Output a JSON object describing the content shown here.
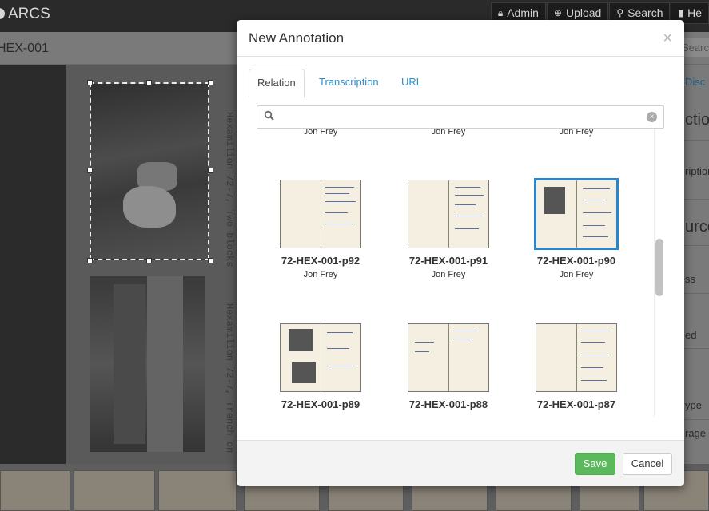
{
  "app": {
    "brand": "ARCS",
    "page_title": "HEX-001"
  },
  "topnav": [
    {
      "label": "Admin",
      "icon": "lock-icon"
    },
    {
      "label": "Upload",
      "icon": "upload-icon"
    },
    {
      "label": "Search",
      "icon": "search-icon"
    },
    {
      "label": "He",
      "icon": "book-icon"
    }
  ],
  "subbar": {
    "search_placeholder": "Searc"
  },
  "viewer": {
    "caption_top": "Hexamilion 72-7, Two blocks",
    "caption_bottom": "Hexamilion 72-7, Trench on"
  },
  "rightpanel": {
    "link": "Disc",
    "section1": "ction",
    "field1": "ription",
    "section2": "urce",
    "field2": "ss",
    "field3": "ed",
    "field4": "ype",
    "field5": "rage"
  },
  "modal": {
    "title": "New Annotation",
    "close": "×",
    "tabs": [
      "Relation",
      "Transcription",
      "URL"
    ],
    "active_tab": "Relation",
    "search": {
      "value": "",
      "placeholder": ""
    },
    "top_row_authors": [
      "Jon Frey",
      "Jon Frey",
      "Jon Frey"
    ],
    "items": [
      {
        "name": "72-HEX-001-p92",
        "author": "Jon Frey",
        "selected": false
      },
      {
        "name": "72-HEX-001-p91",
        "author": "Jon Frey",
        "selected": false
      },
      {
        "name": "72-HEX-001-p90",
        "author": "Jon Frey",
        "selected": true
      },
      {
        "name": "72-HEX-001-p89",
        "author": "",
        "selected": false
      },
      {
        "name": "72-HEX-001-p88",
        "author": "",
        "selected": false
      },
      {
        "name": "72-HEX-001-p87",
        "author": "",
        "selected": false
      }
    ],
    "buttons": {
      "save": "Save",
      "cancel": "Cancel"
    },
    "colors": {
      "accent": "#2b86c9",
      "save": "#5cb85c",
      "link": "#2d8fcf"
    }
  }
}
